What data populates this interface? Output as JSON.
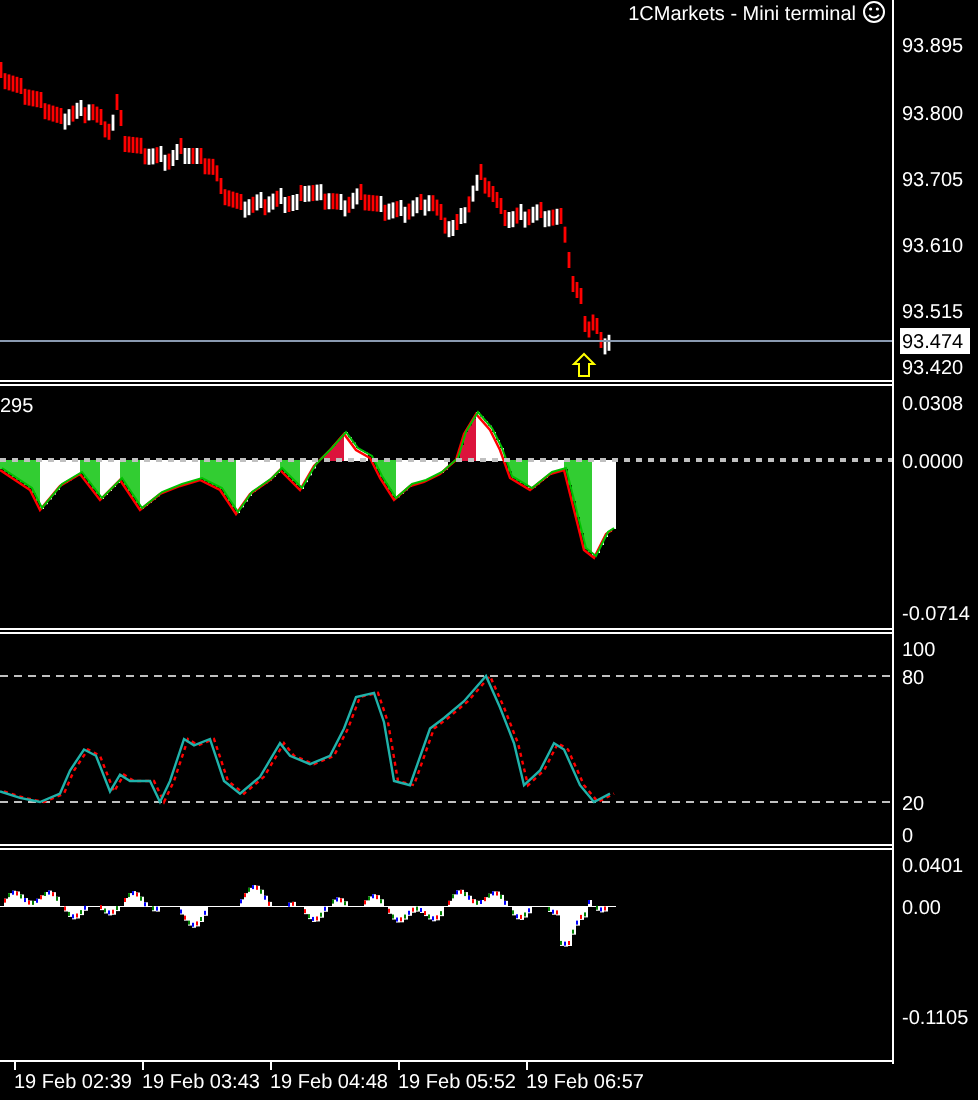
{
  "title": "1CMarkets - Mini terminal",
  "panes": [
    {
      "kind": "price",
      "axis_labels": [
        "93.895",
        "93.800",
        "93.705",
        "93.610",
        "93.515",
        "93.420"
      ],
      "current_price": "93.474"
    },
    {
      "kind": "histogram",
      "indicator_label": "295",
      "axis_labels": [
        "0.0308",
        "0.0000",
        "-0.0714"
      ]
    },
    {
      "kind": "oscillator",
      "axis_labels": [
        "100",
        "80",
        "20",
        "0"
      ]
    },
    {
      "kind": "spikes",
      "axis_labels": [
        "0.0401",
        "0.00",
        "-0.1105"
      ]
    }
  ],
  "time_labels": [
    "19 Feb 02:39",
    "19 Feb 03:43",
    "19 Feb 04:48",
    "19 Feb 05:52",
    "19 Feb 06:57"
  ]
}
